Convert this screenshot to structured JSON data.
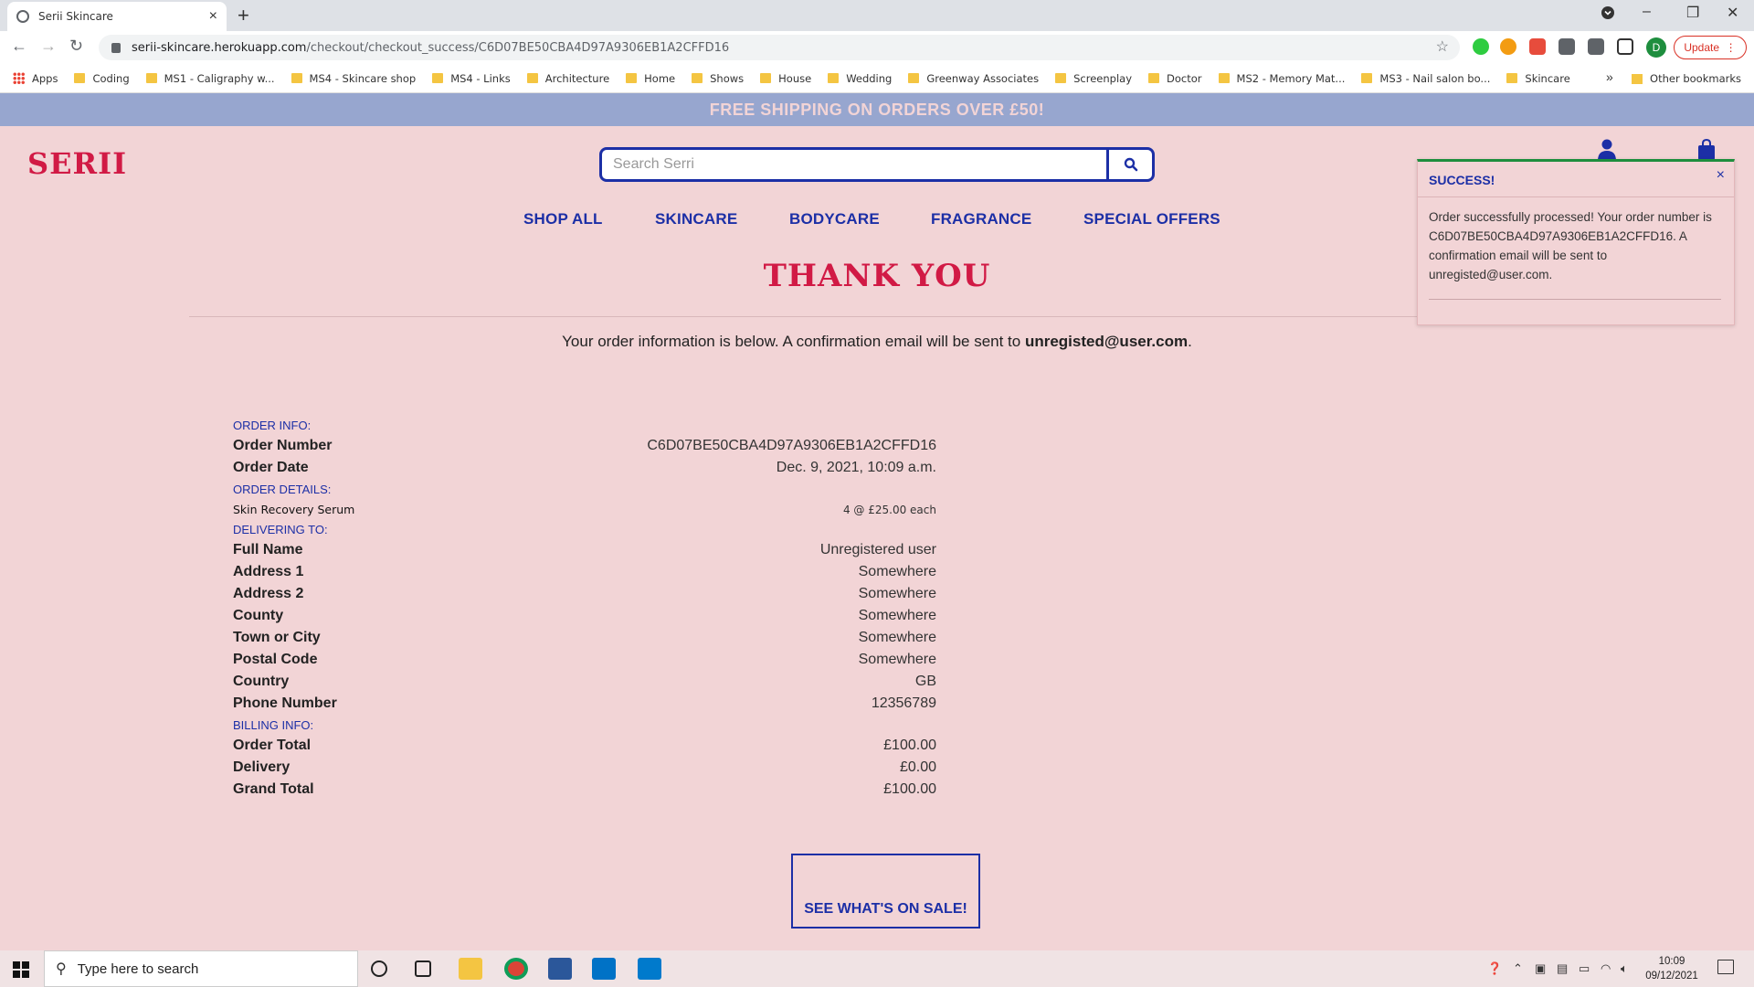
{
  "browser": {
    "tab_title": "Serii Skincare",
    "url_host": "serii-skincare.herokuapp.com",
    "url_path": "/checkout/checkout_success/C6D07BE50CBA4D97A9306EB1A2CFFD16",
    "profile_initial": "D",
    "update_label": "Update",
    "bookmarks": [
      "Coding",
      "MS1 - Caligraphy w...",
      "MS4 - Skincare shop",
      "MS4 - Links",
      "Architecture",
      "Home",
      "Shows",
      "House",
      "Wedding",
      "Greenway Associates",
      "Screenplay",
      "Doctor",
      "MS2 - Memory Mat...",
      "MS3 - Nail salon bo...",
      "Skincare"
    ],
    "apps_label": "Apps",
    "other_bookmarks": "Other bookmarks"
  },
  "site": {
    "promo": "FREE SHIPPING ON ORDERS OVER £50!",
    "logo": "SERII",
    "search_placeholder": "Search Serri",
    "nav": [
      "SHOP ALL",
      "SKINCARE",
      "BODYCARE",
      "FRAGRANCE",
      "SPECIAL OFFERS"
    ],
    "heading": "THANK YOU",
    "confirm_text": "Your order information is below. A confirmation email will be sent to ",
    "confirm_email": "unregisted@user.com",
    "confirm_end": ".",
    "sections": {
      "order_info": "ORDER INFO:",
      "order_details": "ORDER DETAILS:",
      "delivering_to": "DELIVERING TO:",
      "billing_info": "BILLING INFO:"
    },
    "order_info": [
      {
        "label": "Order Number",
        "value": "C6D07BE50CBA4D97A9306EB1A2CFFD16"
      },
      {
        "label": "Order Date",
        "value": "Dec. 9, 2021, 10:09 a.m."
      }
    ],
    "order_items": [
      {
        "name": "Skin Recovery Serum",
        "qty_price": "4 @ £25.00 each"
      }
    ],
    "delivery": [
      {
        "label": "Full Name",
        "value": "Unregistered user"
      },
      {
        "label": "Address 1",
        "value": "Somewhere"
      },
      {
        "label": "Address 2",
        "value": "Somewhere"
      },
      {
        "label": "County",
        "value": "Somewhere"
      },
      {
        "label": "Town or City",
        "value": "Somewhere"
      },
      {
        "label": "Postal Code",
        "value": "Somewhere"
      },
      {
        "label": "Country",
        "value": "GB"
      },
      {
        "label": "Phone Number",
        "value": "12356789"
      }
    ],
    "billing": [
      {
        "label": "Order Total",
        "value": "£100.00"
      },
      {
        "label": "Delivery",
        "value": "£0.00"
      },
      {
        "label": "Grand Total",
        "value": "£100.00"
      }
    ],
    "sale_button": "SEE WHAT'S ON SALE!"
  },
  "toast": {
    "title": "SUCCESS!",
    "close": "×",
    "message": "Order successfully processed! Your order number is C6D07BE50CBA4D97A9306EB1A2CFFD16. A confirmation email will be sent to unregisted@user.com."
  },
  "taskbar": {
    "search_placeholder": "Type here to search",
    "time": "10:09",
    "date": "09/12/2021"
  },
  "colors": {
    "page_bg": "#f2d4d6",
    "brand_red": "#d11a45",
    "brand_blue": "#1c2fa6",
    "promo_bg": "#97a6cf"
  }
}
